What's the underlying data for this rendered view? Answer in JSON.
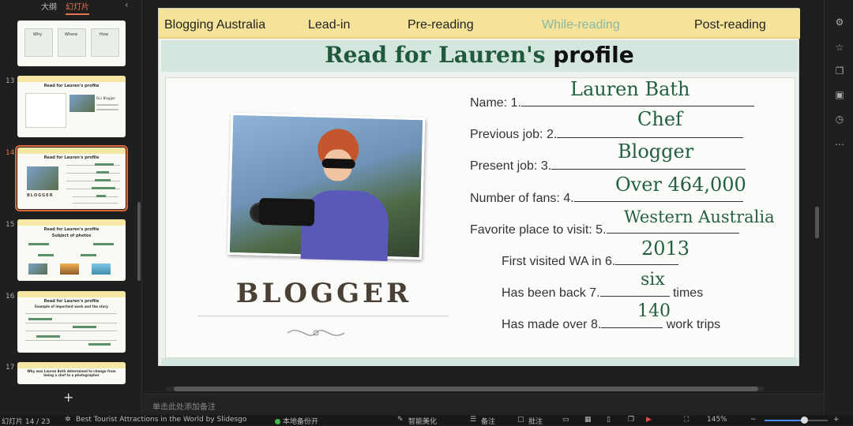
{
  "left_panel": {
    "tabs": [
      "大纲",
      "幻灯片"
    ],
    "active_tab": "幻灯片",
    "thumbnails": [
      {
        "number": "",
        "title": "",
        "labels": [
          "Why",
          "Where",
          "How"
        ]
      },
      {
        "number": "13",
        "title": "Read for Lauren's profile",
        "labels": [
          "Our Blogger"
        ]
      },
      {
        "number": "14",
        "title": "Read for Lauren's profile",
        "labels": [
          "BLOGGER"
        ],
        "active": true
      },
      {
        "number": "15",
        "title": "Read for Lauren's profile",
        "labels": [
          "Subject of photos"
        ]
      },
      {
        "number": "16",
        "title": "Read for Lauren's profile",
        "labels": [
          "Example of important work and the story"
        ]
      },
      {
        "number": "17",
        "title": "Why was Lauren Bath determined to change from being a chef to a photographer",
        "labels": []
      }
    ],
    "add_slide": "+"
  },
  "slide": {
    "nav": [
      "Blogging Australia",
      "Lead-in",
      "Pre-reading",
      "While-reading",
      "Post-reading"
    ],
    "nav_current_index": 3,
    "title_part1": "Read for Lauren's ",
    "title_part2": "profile",
    "blogger_word": "BLOGGER",
    "fields": [
      {
        "label": "Name: 1.",
        "answer": "Lauren Bath",
        "suffix": ""
      },
      {
        "label": "Previous job: 2.",
        "answer": "Chef",
        "suffix": ""
      },
      {
        "label": "Present job: 3.",
        "answer": "Blogger",
        "suffix": ""
      },
      {
        "label": "Number of fans: 4.",
        "answer": "Over 464,000",
        "suffix": ""
      },
      {
        "label": "Favorite place to visit: 5.",
        "answer": "Western Australia",
        "suffix": ""
      },
      {
        "label": "First visited WA in 6.",
        "answer": "2013",
        "suffix": ""
      },
      {
        "label": "Has been back 7.",
        "answer": "six",
        "suffix": " times"
      },
      {
        "label": "Has made over 8.",
        "answer": "140",
        "suffix": " work trips"
      }
    ]
  },
  "notes": {
    "placeholder": "单击此处添加备注"
  },
  "status_bar": {
    "slide_counter": "幻灯片 14 / 23",
    "theme": "Best Tourist Attractions in the World by Slidesgo",
    "backup": "本地备份开",
    "smart": "智能美化",
    "notes_btn": "备注",
    "comment_btn": "批注",
    "zoom": "145%",
    "zoom_level": 0.62
  },
  "colors": {
    "accent": "#e9734e",
    "nav_band": "#f6e39a",
    "answer_green": "#23603f",
    "title_green": "#1f5a3d"
  }
}
